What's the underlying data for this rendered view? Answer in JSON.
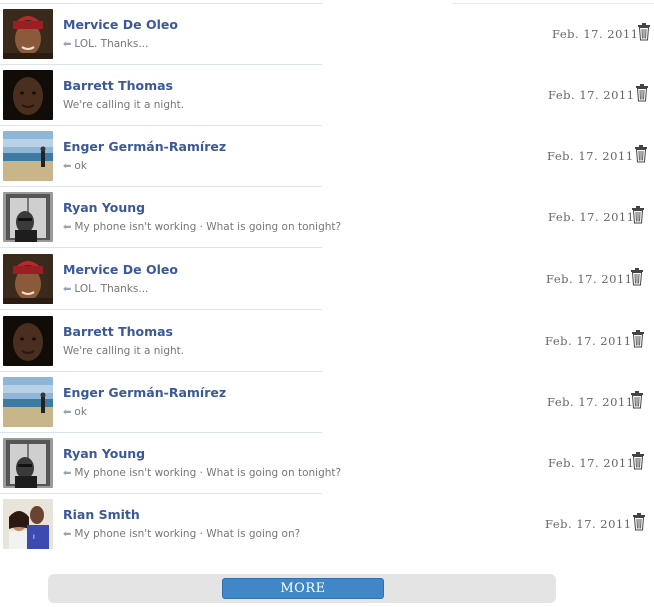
{
  "messages": [
    {
      "name": "Mervice De Oleo",
      "snippet": "LOL. Thanks...",
      "replied": true,
      "date": "Feb. 17. 2011",
      "avatar": "woman-headwrap"
    },
    {
      "name": "Barrett Thomas",
      "snippet": "We're calling it a night.",
      "replied": false,
      "date": "Feb. 17. 2011",
      "avatar": "man-portrait"
    },
    {
      "name": "Enger Germán-Ramírez",
      "snippet": "ok",
      "replied": true,
      "date": "Feb. 17. 2011",
      "avatar": "beach-scene"
    },
    {
      "name": "Ryan Young",
      "snippet": "My phone isn't working · What is going on tonight?",
      "replied": true,
      "date": "Feb. 17. 2011",
      "avatar": "elevator-bw"
    },
    {
      "name": "Mervice De Oleo",
      "snippet": "LOL. Thanks...",
      "replied": true,
      "date": "Feb. 17. 2011",
      "avatar": "woman-headwrap"
    },
    {
      "name": "Barrett Thomas",
      "snippet": "We're calling it a night.",
      "replied": false,
      "date": "Feb. 17. 2011",
      "avatar": "man-portrait"
    },
    {
      "name": "Enger Germán-Ramírez",
      "snippet": "ok",
      "replied": true,
      "date": "Feb. 17. 2011",
      "avatar": "beach-scene"
    },
    {
      "name": "Ryan Young",
      "snippet": "My phone isn't working · What is going on tonight?",
      "replied": true,
      "date": "Feb. 17. 2011",
      "avatar": "elevator-bw"
    },
    {
      "name": "Rian Smith",
      "snippet": "My phone isn't working · What is going on?",
      "replied": true,
      "date": "Feb. 17. 2011",
      "avatar": "couple-photo"
    }
  ],
  "more_button": {
    "label": "MORE"
  },
  "colors": {
    "name_link": "#3b5998",
    "more_button": "#3f87c7",
    "more_bar": "#e4e4e4"
  },
  "icons": {
    "reply": "reply-arrow-icon",
    "delete": "trash-icon"
  }
}
